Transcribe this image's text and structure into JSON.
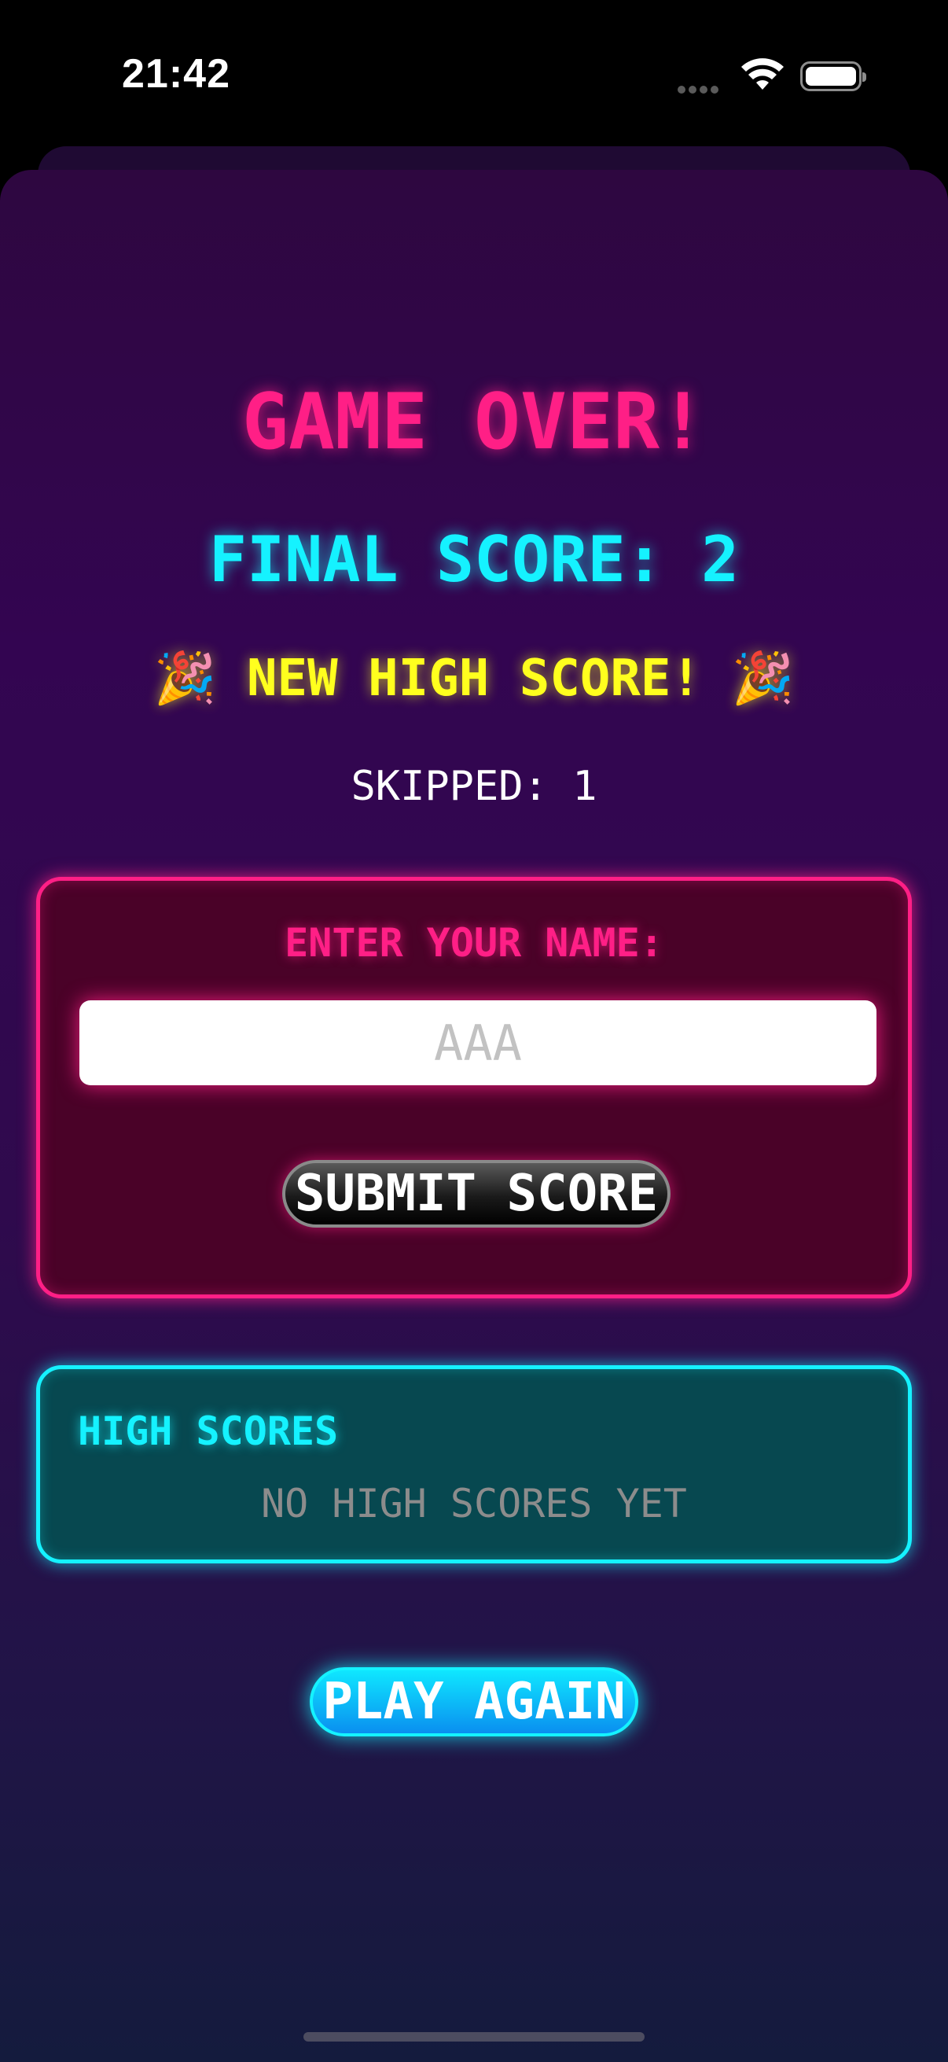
{
  "status_bar": {
    "time": "21:42"
  },
  "game_over": {
    "title": "GAME OVER!",
    "final_score": "FINAL SCORE: 2",
    "high_score_banner": "🎉 NEW HIGH SCORE! 🎉",
    "skipped": "SKIPPED: 1"
  },
  "name_entry": {
    "label": "ENTER YOUR NAME:",
    "input_value": "",
    "input_placeholder": "AAA",
    "submit_label": "SUBMIT SCORE"
  },
  "high_scores": {
    "heading": "HIGH SCORES",
    "empty_message": "NO HIGH SCORES YET"
  },
  "actions": {
    "play_again_label": "PLAY AGAIN"
  },
  "colors": {
    "accent_pink": "#ff1f86",
    "accent_cyan": "#15f2ff",
    "accent_yellow": "#ffff1e"
  }
}
